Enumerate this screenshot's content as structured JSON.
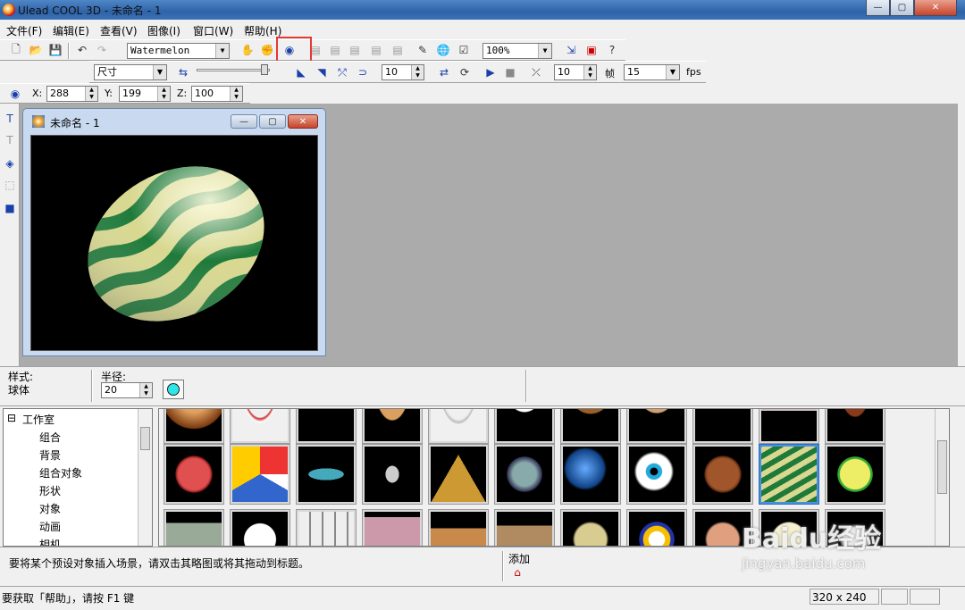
{
  "app": {
    "title": "Ulead COOL 3D - 未命名 - 1",
    "win_min": "—",
    "win_max": "▢",
    "win_close": "✕"
  },
  "menu": [
    "文件(F)",
    "编辑(E)",
    "查看(V)",
    "图像(I)",
    "窗口(W)",
    "帮助(H)"
  ],
  "toolbar1": {
    "object_select": "Watermelon",
    "zoom": "100%"
  },
  "toolbar2": {
    "size_select": "尺寸",
    "value_a": "10",
    "value_b": "10",
    "frames_label": "帧",
    "frames": "15",
    "fps_label": "fps"
  },
  "coords": {
    "x_label": "X:",
    "x": "288",
    "y_label": "Y:",
    "y": "199",
    "z_label": "Z:",
    "z": "100"
  },
  "child_window": {
    "title": "未命名 - 1"
  },
  "properties": {
    "style_label": "样式:",
    "style_value": "球体",
    "radius_label": "半径:",
    "radius_value": "20"
  },
  "tree": {
    "root": "工作室",
    "items": [
      "组合",
      "背景",
      "组合对象",
      "形状",
      "对象",
      "动画",
      "相机"
    ]
  },
  "gallery": {
    "rows": [
      [
        "donut",
        "necklace",
        "green-cone",
        "wood-disc",
        "pearls",
        "snowman",
        "bear",
        "teddy",
        "box",
        "cube",
        "football"
      ],
      [
        "basketball",
        "beach-ball",
        "ufo",
        "diamond",
        "pyramid-face",
        "mountain-globe",
        "earth",
        "eyeball",
        "coconut",
        "watermelon",
        "lime"
      ],
      [
        "letter-cube",
        "dice",
        "rubik-cube",
        "frame",
        "wood-block",
        "sand-tile",
        "cheese",
        "first-medal",
        "button",
        "plate",
        "cloud"
      ]
    ],
    "selected": "watermelon",
    "colors": {
      "melon_dark": "#1f7a3a",
      "melon_light": "#d8d890"
    }
  },
  "hint": {
    "text": "要将某个预设对象插入场景，请双击其略图或将其拖动到标题。",
    "add_label": "添加"
  },
  "status": {
    "text": "要获取「帮助」，请按 F1 键",
    "size": "320 x 240"
  },
  "watermark": {
    "text": "Baidu经验",
    "url": "jingyan.baidu.com"
  }
}
